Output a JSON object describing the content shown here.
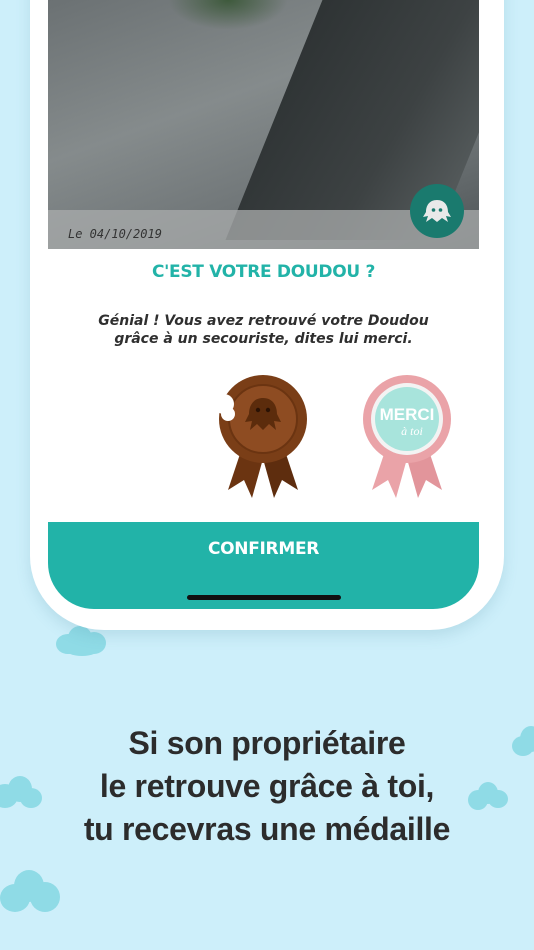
{
  "photo": {
    "date_label": "Le 04/10/2019"
  },
  "card": {
    "question": "C'EST VOTRE DOUDOU ?",
    "message_line1": "Génial ! Vous avez retrouvé votre Doudou",
    "message_line2": "grâce à un secouriste, dites lui merci.",
    "medals": [
      {
        "name": "chocolate",
        "icon": "chocolate-medal-icon"
      },
      {
        "name": "merci",
        "icon": "merci-medal-icon",
        "text_main": "MERCI",
        "text_sub": "à toi"
      }
    ],
    "confirm_label": "CONFIRMER"
  },
  "tagline": {
    "line1": "Si son propriétaire",
    "line2": "le retrouve grâce à toi,",
    "line3": "tu recevras une médaille"
  },
  "colors": {
    "background": "#cdeffa",
    "accent": "#22b3a8",
    "badge": "#1a7a6e",
    "chocolate": "#7a3e17",
    "pink": "#eaa3a8",
    "mint": "#a8e4dc"
  }
}
